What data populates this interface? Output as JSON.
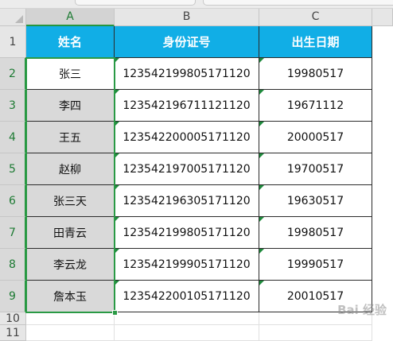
{
  "columns": [
    "A",
    "B",
    "C"
  ],
  "rows": [
    "1",
    "2",
    "3",
    "4",
    "5",
    "6",
    "7",
    "8",
    "9",
    "10",
    "11"
  ],
  "headers": [
    "姓名",
    "身份证号",
    "出生日期"
  ],
  "data": [
    [
      "张三",
      "123542199805171120",
      "19980517"
    ],
    [
      "李四",
      "123542196711121120",
      "19671112"
    ],
    [
      "王五",
      "123542200005171120",
      "20000517"
    ],
    [
      "赵柳",
      "123542197005171120",
      "19700517"
    ],
    [
      "张三天",
      "123542196305171120",
      "19630517"
    ],
    [
      "田青云",
      "123542199805171120",
      "19980517"
    ],
    [
      "李云龙",
      "123542199905171120",
      "19990517"
    ],
    [
      "詹本玉",
      "123542200105171120",
      "20010517"
    ]
  ],
  "watermark": "Bai 经验",
  "colors": {
    "header_bg": "#11aee6",
    "header_text": "#ffffff",
    "selection": "#2a9a45",
    "column_a_fill": "#d9d9d9"
  }
}
